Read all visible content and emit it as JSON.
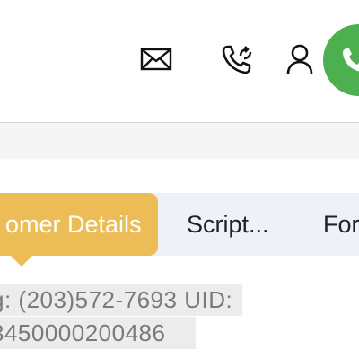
{
  "header": {
    "icons": [
      "mail-icon",
      "phone-sync-icon",
      "user-icon",
      "call-icon"
    ],
    "call_button_color": "#4caf50"
  },
  "tabs": {
    "items": [
      {
        "label": "omer Details",
        "active": true
      },
      {
        "label": "Script...",
        "active": false
      },
      {
        "label": "For",
        "active": false
      }
    ],
    "active_color": "#ecbd57",
    "bar_color": "#eef1f8"
  },
  "details": {
    "line1": "g: (203)572-7693 UID:",
    "line2": "3450000200486"
  }
}
